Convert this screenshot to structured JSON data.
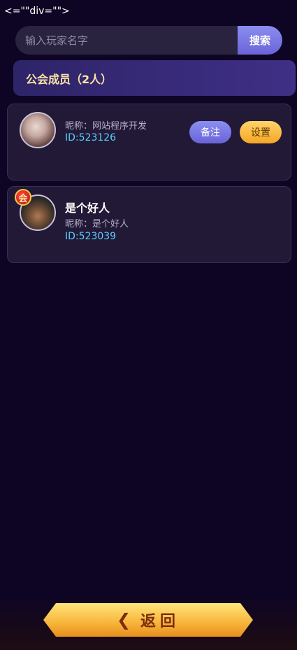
{
  "stray_text": "<=\"\"div=\"\">",
  "search": {
    "placeholder": "输入玩家名字",
    "button_label": "搜索"
  },
  "members_header": "公会成员（2人）",
  "members": [
    {
      "name": "",
      "nick": "昵称：网站程序开发",
      "id": "ID:523126",
      "note_label": "备注",
      "settings_label": "设置"
    },
    {
      "name": "是个好人",
      "nick": "昵称：是个好人",
      "id": "ID:523039",
      "badge": "会"
    }
  ],
  "back_label": "返回",
  "colors": {
    "background": "#0e0524",
    "accent": "#6a64d8",
    "gold": "#f5a623",
    "id_text": "#5ad0ff"
  }
}
